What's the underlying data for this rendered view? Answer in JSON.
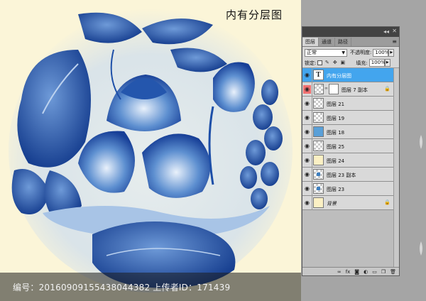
{
  "canvas": {
    "title": "内有分层图",
    "watermark": "编号：20160909155438044382 上传者ID：171439"
  },
  "panel": {
    "tabs": [
      {
        "label": "图层"
      },
      {
        "label": "通道"
      },
      {
        "label": "路径"
      }
    ],
    "blend_mode": "正常",
    "opacity_label": "不透明度:",
    "opacity_value": "100%",
    "lock_label": "锁定:",
    "fill_label": "填充:",
    "fill_value": "100%",
    "layers": [
      {
        "name": "内有分层图",
        "thumb": "text",
        "thumb_text": "T",
        "selected": true
      },
      {
        "name": "图层 7 副本",
        "thumb": "checker",
        "mask": true,
        "locked": true,
        "eye_red": true
      },
      {
        "name": "图层 21",
        "thumb": "checker"
      },
      {
        "name": "图层 19",
        "thumb": "checker"
      },
      {
        "name": "图层 18",
        "thumb": "blue"
      },
      {
        "name": "图层 25",
        "thumb": "checker"
      },
      {
        "name": "图层 24",
        "thumb": "cream"
      },
      {
        "name": "图层 23 副本",
        "thumb": "checker-dot"
      },
      {
        "name": "图层 23",
        "thumb": "checker-dot"
      },
      {
        "name": "背景",
        "thumb": "cream",
        "locked": true,
        "italic": true
      }
    ],
    "bottom_icons": [
      "link-icon",
      "fx-icon",
      "mask-icon",
      "adjustment-icon",
      "folder-icon",
      "new-layer-icon",
      "trash-icon"
    ]
  },
  "colors": {
    "canvas_bg": "#fbf5d8",
    "selected_layer": "#43a5ee",
    "porcelain_blue": "#1d4fa8"
  }
}
